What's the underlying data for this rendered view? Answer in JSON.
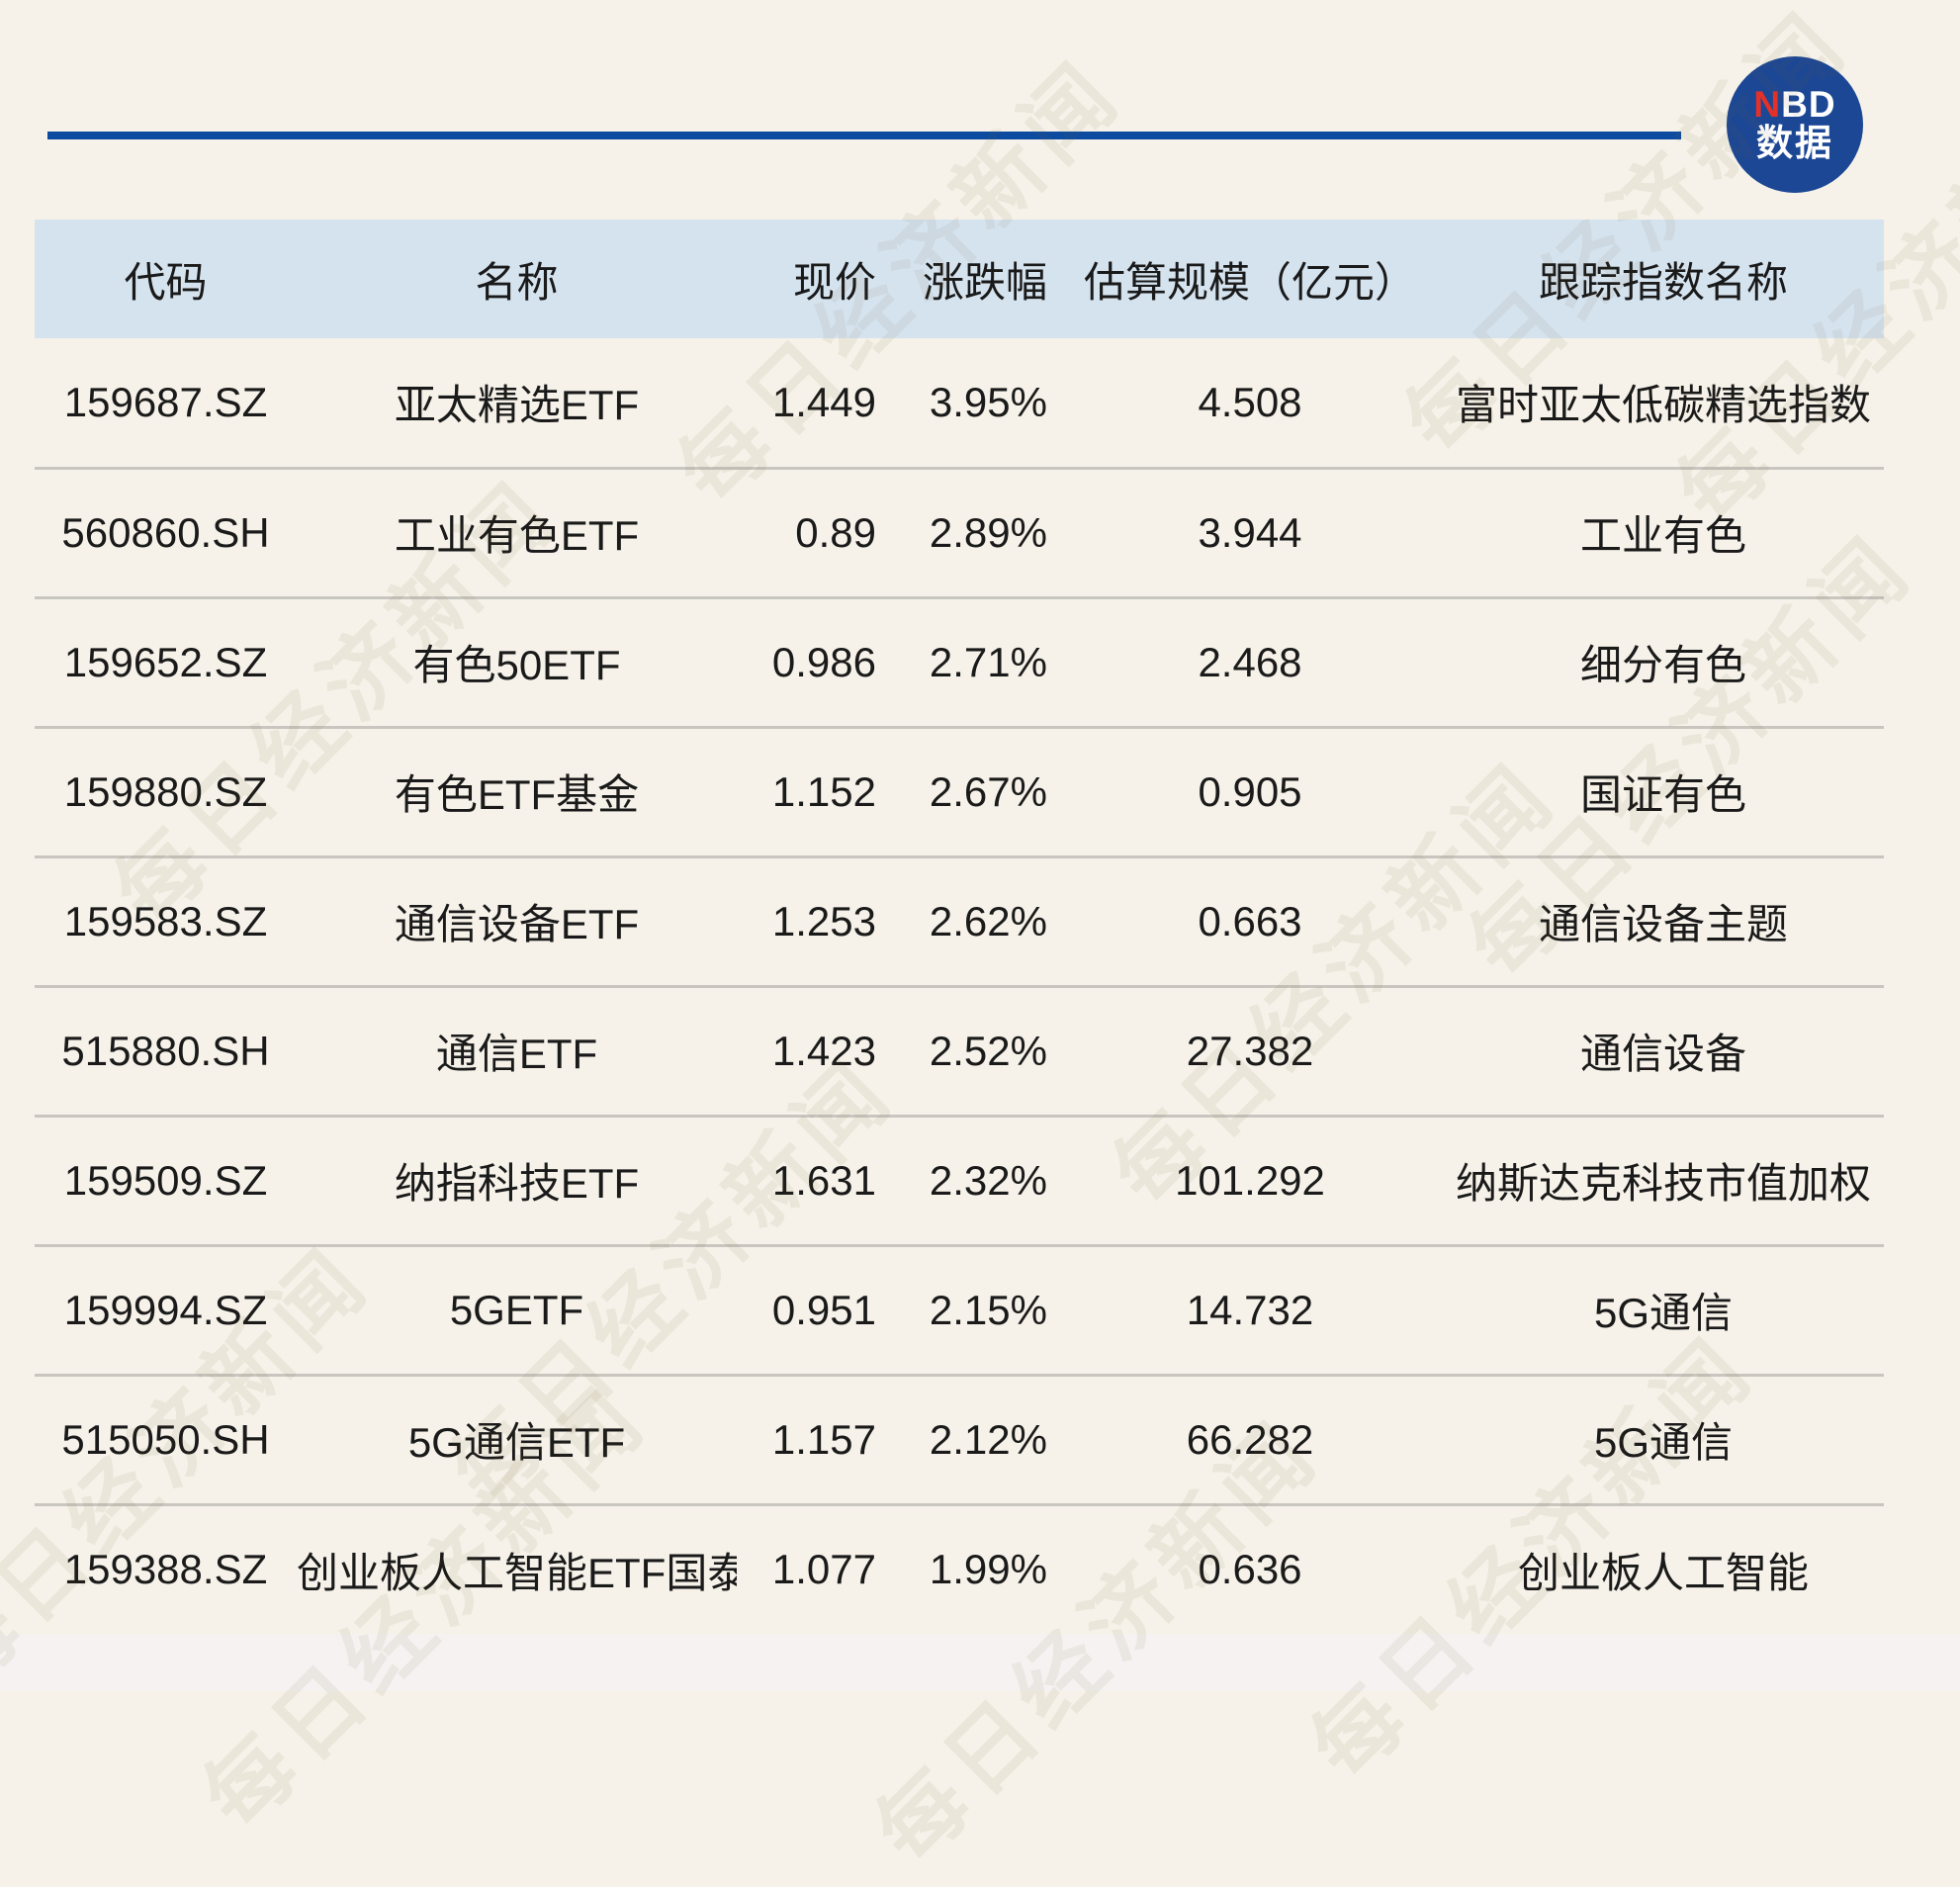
{
  "brand": {
    "logo_n": "N",
    "logo_bd": "BD",
    "logo_cn": "数据",
    "logo_bg_color": "#1c4795",
    "logo_red_color": "#e33128",
    "rule_color": "#0c4ba0"
  },
  "watermark": {
    "text": "每日经济新闻"
  },
  "table_style": {
    "header_bg_color": "#d5e3ef",
    "page_bg_color": "#f6f2e9",
    "divider_color": "#c9c6c0"
  },
  "chart_data": {
    "type": "table",
    "columns": [
      "代码",
      "名称",
      "现价",
      "涨跌幅",
      "估算规模（亿元）",
      "跟踪指数名称"
    ],
    "rows": [
      [
        "159687.SZ",
        "亚太精选ETF",
        "1.449",
        "3.95%",
        "4.508",
        "富时亚太低碳精选指数"
      ],
      [
        "560860.SH",
        "工业有色ETF",
        "0.89",
        "2.89%",
        "3.944",
        "工业有色"
      ],
      [
        "159652.SZ",
        "有色50ETF",
        "0.986",
        "2.71%",
        "2.468",
        "细分有色"
      ],
      [
        "159880.SZ",
        "有色ETF基金",
        "1.152",
        "2.67%",
        "0.905",
        "国证有色"
      ],
      [
        "159583.SZ",
        "通信设备ETF",
        "1.253",
        "2.62%",
        "0.663",
        "通信设备主题"
      ],
      [
        "515880.SH",
        "通信ETF",
        "1.423",
        "2.52%",
        "27.382",
        "通信设备"
      ],
      [
        "159509.SZ",
        "纳指科技ETF",
        "1.631",
        "2.32%",
        "101.292",
        "纳斯达克科技市值加权"
      ],
      [
        "159994.SZ",
        "5GETF",
        "0.951",
        "2.15%",
        "14.732",
        "5G通信"
      ],
      [
        "515050.SH",
        "5G通信ETF",
        "1.157",
        "2.12%",
        "66.282",
        "5G通信"
      ],
      [
        "159388.SZ",
        "创业板人工智能ETF国泰",
        "1.077",
        "1.99%",
        "0.636",
        "创业板人工智能"
      ]
    ]
  }
}
